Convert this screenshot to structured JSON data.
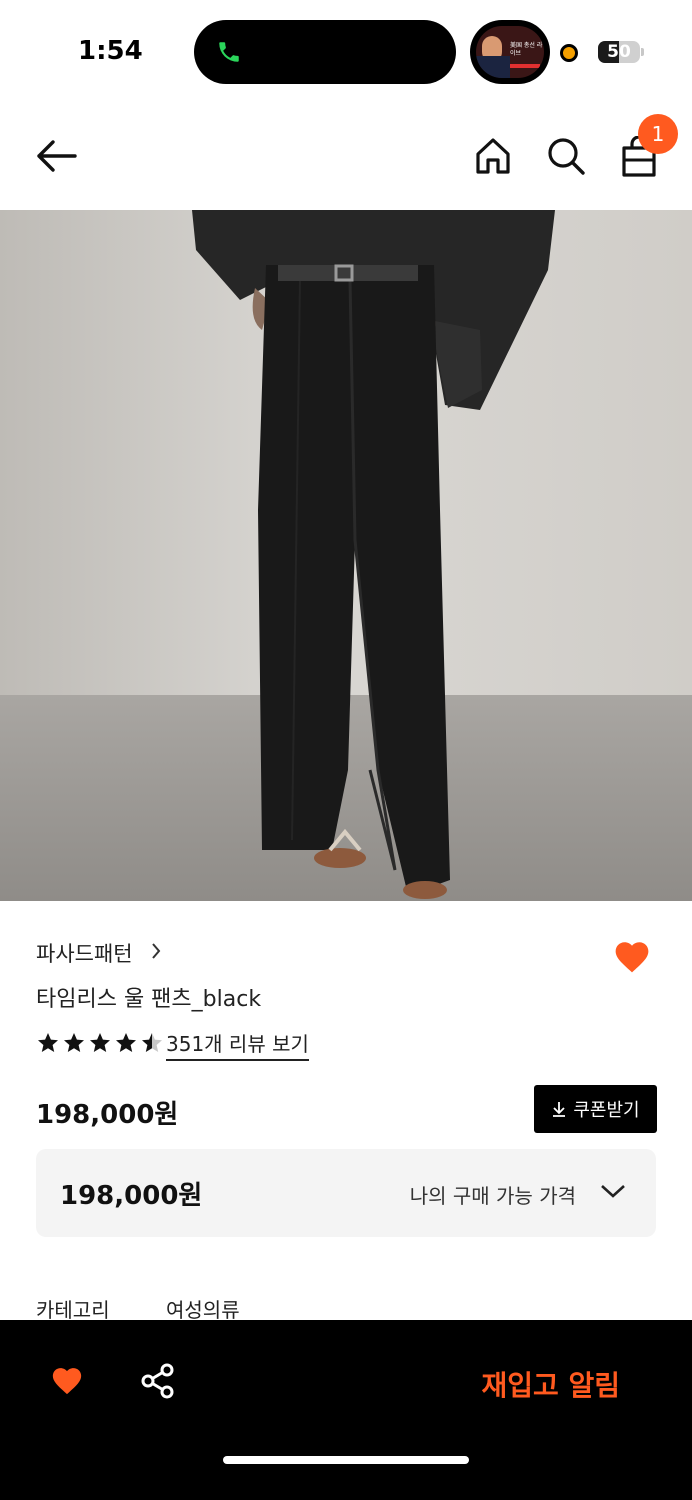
{
  "status_bar": {
    "time": "1:54",
    "battery": "50",
    "battery_level": 0.5,
    "pip_text": "美国 총선 라이브"
  },
  "nav": {
    "cart_count": "1"
  },
  "product": {
    "brand": "파사드패턴",
    "title": "타임리스 울 팬츠_black",
    "rating": 4.5,
    "review_link": "351개 리뷰 보기",
    "price": "198,000원",
    "coupon_label": "쿠폰받기",
    "my_price": "198,000원",
    "my_price_label": "나의 구매 가능 가격",
    "category_label": "카테고리",
    "category_value": "여성의류"
  },
  "bottom_bar": {
    "restock_label": "재입고 알림"
  },
  "colors": {
    "accent": "#ff5a1f",
    "bottom_bar": "#000000"
  },
  "icons": [
    "phone-icon",
    "back-arrow-icon",
    "home-icon",
    "search-icon",
    "shopping-bag-icon",
    "chevron-right-icon",
    "heart-icon",
    "star-icon",
    "download-icon",
    "chevron-down-icon",
    "share-icon"
  ]
}
